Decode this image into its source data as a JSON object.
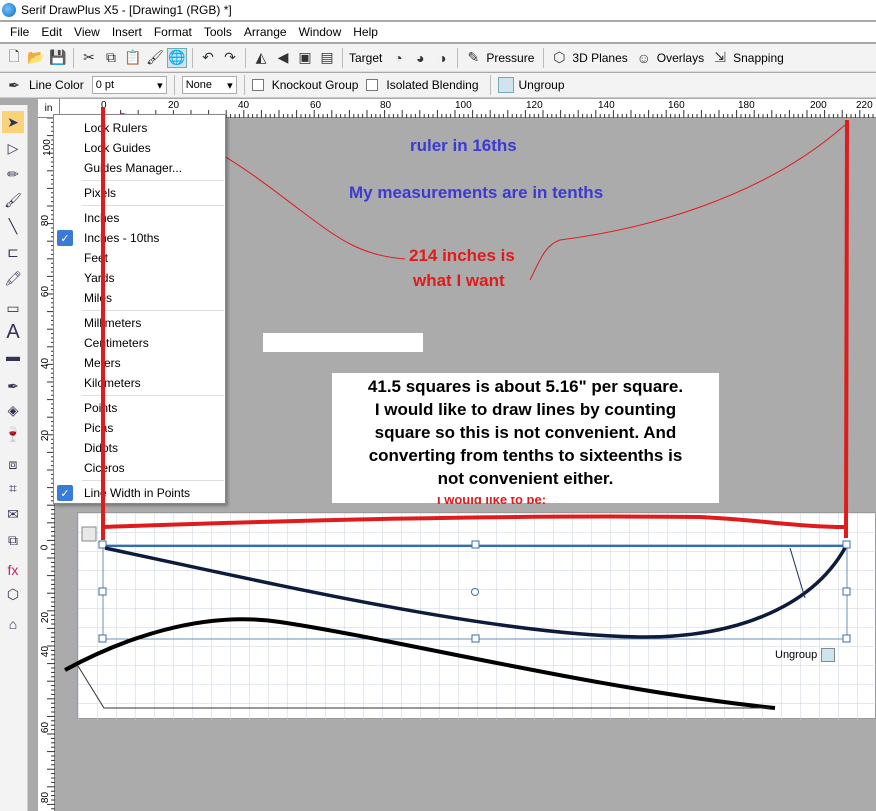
{
  "window": {
    "title": "Serif DrawPlus X5 - [Drawing1 (RGB) *]"
  },
  "menu": {
    "items": [
      "File",
      "Edit",
      "View",
      "Insert",
      "Format",
      "Tools",
      "Arrange",
      "Window",
      "Help"
    ]
  },
  "toolbar1": {
    "target_label": "Target",
    "pressure_label": "Pressure",
    "planes_label": "3D Planes",
    "overlays_label": "Overlays",
    "snapping_label": "Snapping"
  },
  "toolbar2": {
    "line_color_label": "Line Color",
    "line_width_value": "0 pt",
    "line_style_value": "None",
    "knockout_label": "Knockout Group",
    "isolated_label": "Isolated Blending",
    "ungroup_label": "Ungroup"
  },
  "ruler": {
    "unit_label": "in",
    "h_ticks": [
      "0",
      "20",
      "40",
      "60",
      "80",
      "100",
      "120",
      "140",
      "160",
      "180",
      "200",
      "220"
    ],
    "v_ticks_top": [
      "100",
      "80",
      "60",
      "40",
      "20"
    ],
    "v_ticks_bottom": [
      "0",
      "20",
      "40",
      "60",
      "80"
    ]
  },
  "context_menu": {
    "items": [
      {
        "label": "Lock Rulers",
        "checked": false
      },
      {
        "label": "Lock Guides",
        "checked": false
      },
      {
        "label": "Guides Manager...",
        "checked": false
      },
      {
        "label": "Pixels",
        "checked": false
      },
      {
        "label": "Inches",
        "checked": false
      },
      {
        "label": "Inches - 10ths",
        "checked": true
      },
      {
        "label": "Feet",
        "checked": false
      },
      {
        "label": "Yards",
        "checked": false
      },
      {
        "label": "Miles",
        "checked": false
      },
      {
        "label": "Millimeters",
        "checked": false
      },
      {
        "label": "Centimeters",
        "checked": false
      },
      {
        "label": "Meters",
        "checked": false
      },
      {
        "label": "Kilometers",
        "checked": false
      },
      {
        "label": "Points",
        "checked": false
      },
      {
        "label": "Picas",
        "checked": false
      },
      {
        "label": "Didots",
        "checked": false
      },
      {
        "label": "Ciceros",
        "checked": false
      },
      {
        "label": "Line Width in Points",
        "checked": true
      }
    ]
  },
  "annotations": {
    "ruler_16ths": "ruler in 16ths",
    "measurements_tenths": "My measurements are in tenths",
    "want_line1": "214 inches is",
    "want_line2": "what I want",
    "hidden_text": "I would like to be:",
    "note_lines": [
      "41.5 squares is about 5.16\" per square.",
      "I would like to draw lines by counting",
      "square so this is not convenient.  And",
      "converting from tenths to sixteenths is",
      "not convenient either."
    ]
  },
  "ungroup_tooltip": "Ungroup",
  "colors": {
    "accent_blue": "#3a3ad4",
    "annotation_red": "#e01b1b",
    "check_blue": "#3a7bd5"
  }
}
